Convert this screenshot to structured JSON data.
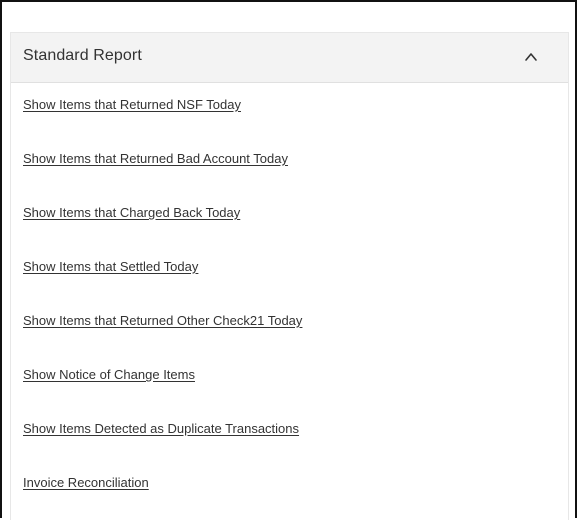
{
  "panel": {
    "title": "Standard Report",
    "toggle_icon": "chevron-up-icon",
    "links": [
      {
        "label": "Show Items that Returned NSF Today"
      },
      {
        "label": "Show Items that Returned Bad Account Today"
      },
      {
        "label": "Show Items that Charged Back Today"
      },
      {
        "label": "Show Items that Settled Today"
      },
      {
        "label": "Show Items that Returned Other Check21 Today"
      },
      {
        "label": "Show Notice of Change Items"
      },
      {
        "label": "Show Items Detected as Duplicate Transactions"
      },
      {
        "label": "Invoice Reconciliation"
      }
    ]
  },
  "colors": {
    "header_bg": "#f3f3f3",
    "text": "#333333",
    "border": "#111111"
  }
}
